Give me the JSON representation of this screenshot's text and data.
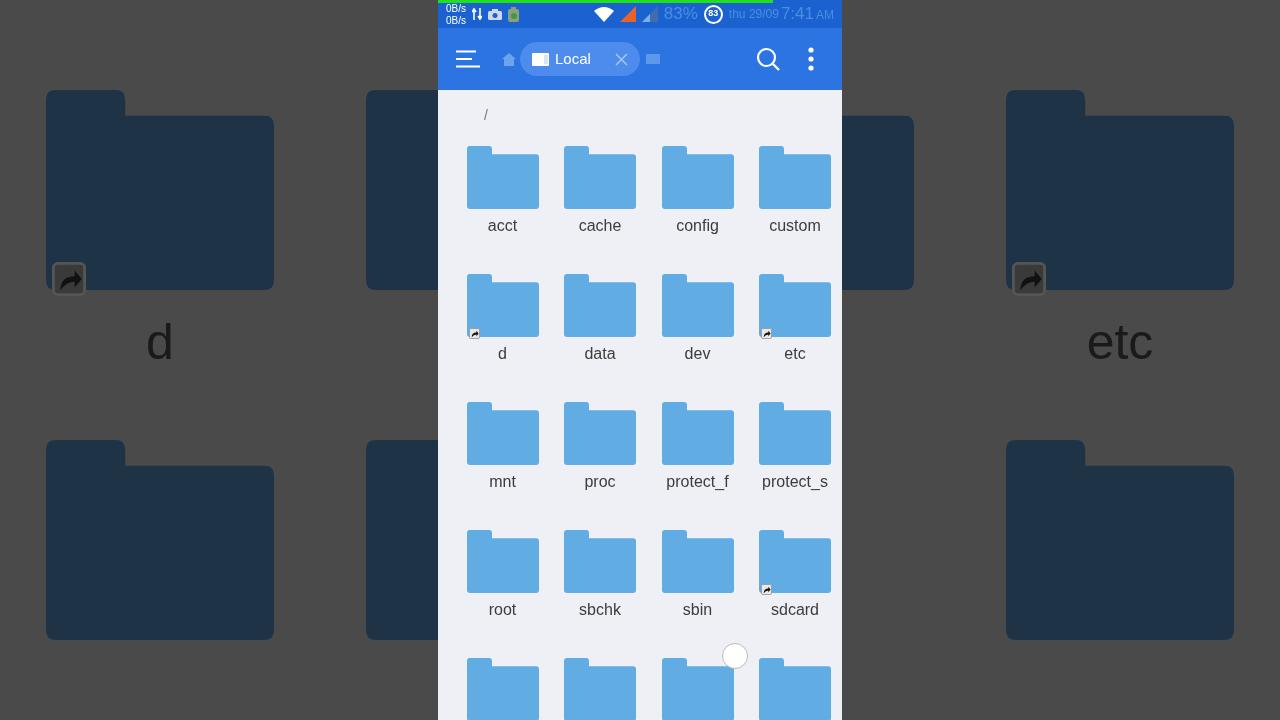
{
  "backdrop": {
    "left_label": "d",
    "right_label": "etc"
  },
  "status_bar": {
    "progress": {
      "level": 0.83
    },
    "net_speed": [
      "0B/s",
      "0B/s"
    ],
    "battery": "83%",
    "badge": "83",
    "date": "thu 29/09",
    "time": "7:41",
    "ampm": "AM"
  },
  "toolbar": {
    "tab": {
      "label": "Local"
    }
  },
  "path": "/",
  "folders": [
    {
      "name": "acct",
      "shortcut": false
    },
    {
      "name": "cache",
      "shortcut": false
    },
    {
      "name": "config",
      "shortcut": false
    },
    {
      "name": "custom",
      "shortcut": false
    },
    {
      "name": "d",
      "shortcut": true
    },
    {
      "name": "data",
      "shortcut": false
    },
    {
      "name": "dev",
      "shortcut": false
    },
    {
      "name": "etc",
      "shortcut": true
    },
    {
      "name": "mnt",
      "shortcut": false
    },
    {
      "name": "proc",
      "shortcut": false
    },
    {
      "name": "protect_f",
      "shortcut": false
    },
    {
      "name": "protect_s",
      "shortcut": false
    },
    {
      "name": "root",
      "shortcut": false
    },
    {
      "name": "sbchk",
      "shortcut": false
    },
    {
      "name": "sbin",
      "shortcut": false
    },
    {
      "name": "sdcard",
      "shortcut": true
    },
    {
      "shortcut": false
    },
    {
      "shortcut": false
    },
    {
      "shortcut": false
    },
    {
      "shortcut": false
    }
  ]
}
